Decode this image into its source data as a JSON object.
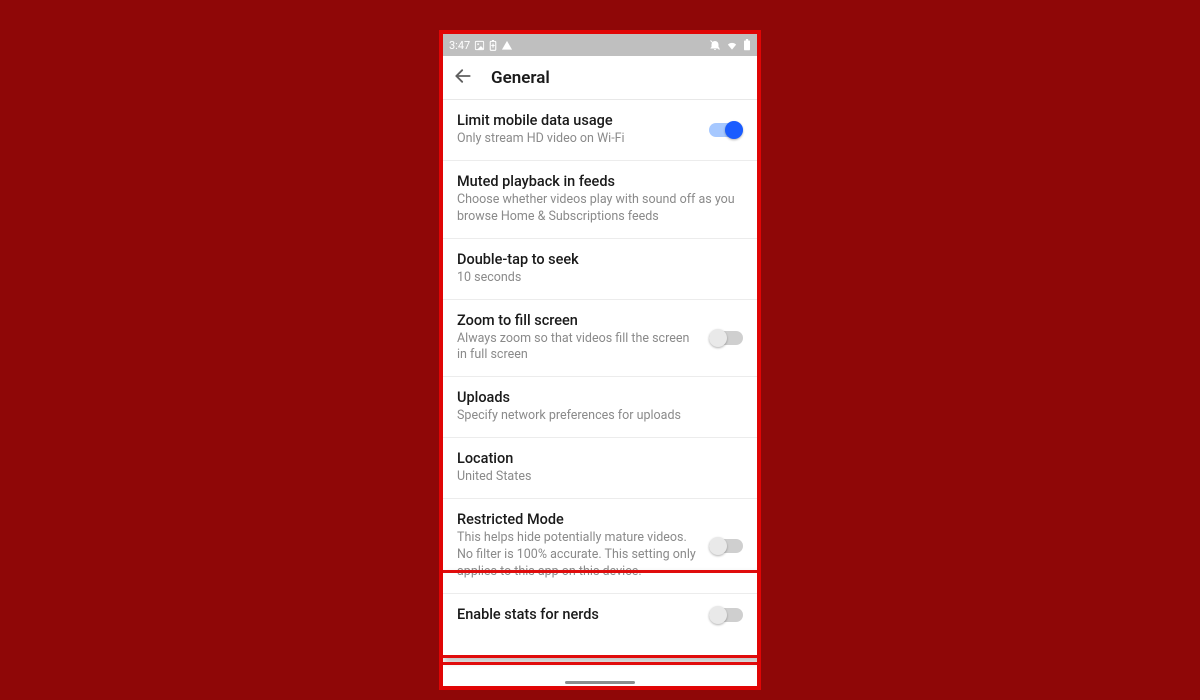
{
  "statusbar": {
    "time": "3:47"
  },
  "appbar": {
    "title": "General"
  },
  "settings": {
    "limit_data": {
      "title": "Limit mobile data usage",
      "sub": "Only stream HD video on Wi-Fi",
      "on": true
    },
    "muted_playback": {
      "title": "Muted playback in feeds",
      "sub": "Choose whether videos play with sound off as you browse Home & Subscriptions feeds"
    },
    "double_tap": {
      "title": "Double-tap to seek",
      "sub": "10 seconds"
    },
    "zoom_fill": {
      "title": "Zoom to fill screen",
      "sub": "Always zoom so that videos fill the screen in full screen",
      "on": false
    },
    "uploads": {
      "title": "Uploads",
      "sub": "Specify network preferences for uploads"
    },
    "location": {
      "title": "Location",
      "sub": "United States"
    },
    "restricted": {
      "title": "Restricted Mode",
      "sub": "This helps hide potentially mature videos. No filter is 100% accurate. This setting only applies to this app on this device.",
      "on": false
    },
    "stats_nerds": {
      "title": "Enable stats for nerds",
      "on": false
    }
  }
}
